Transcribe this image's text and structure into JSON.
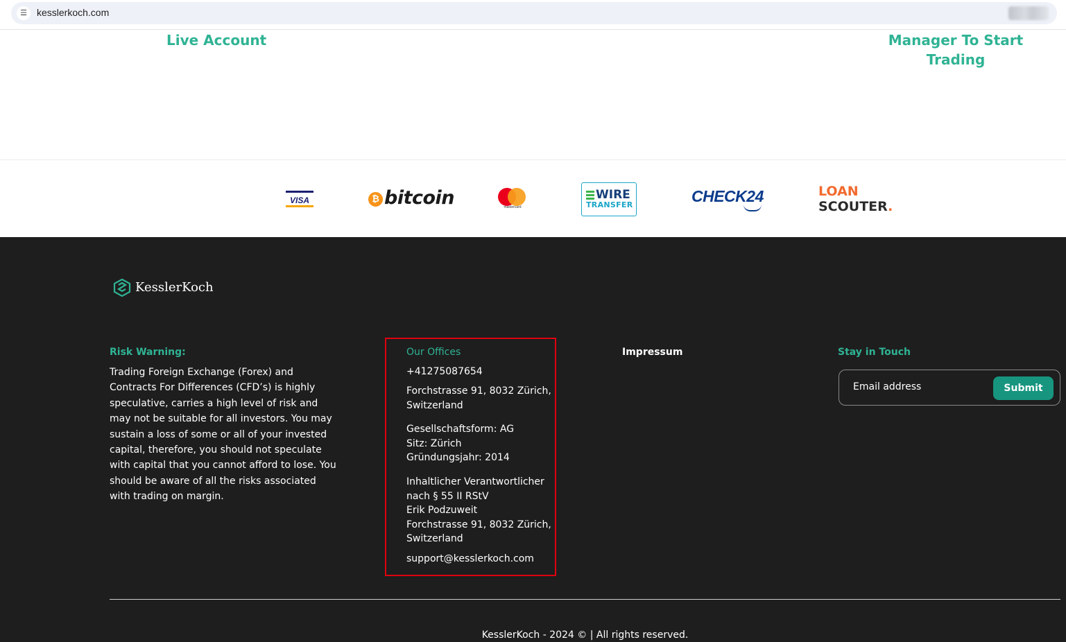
{
  "browser": {
    "url": "kesslerkoch.com",
    "site_info_icon": "tune-icon"
  },
  "hero": {
    "left_link": "Live Account",
    "right_link_line1": "Manager To Start",
    "right_link_line2": "Trading"
  },
  "partners": {
    "visa": "VISA",
    "bitcoin_symbol": "₿",
    "bitcoin": "bitcoin",
    "mastercard": "mastercard",
    "wire_line1": "WIRE",
    "wire_line2": "TRANSFER",
    "check24": "CHECK24",
    "loan_line1": "LOAN",
    "loan_line2": "SCOUTER",
    "loan_dot": "."
  },
  "footer": {
    "brand": "KesslerKoch",
    "risk": {
      "title": "Risk Warning:",
      "text": "Trading Foreign Exchange (Forex) and Contracts For Differences (CFD’s) is highly speculative, carries a high level of risk and may not be suitable for all investors. You may sustain a loss of some or all of your invested capital, therefore, you should not speculate with capital that you cannot afford to lose. You should be aware of all the risks associated with trading on margin."
    },
    "offices": {
      "title": "Our Offices",
      "phone": "+41275087654",
      "address_l1": "Forchstrasse 91, 8032 Zürich,",
      "address_l2": "Switzerland",
      "form": "Gesellschaftsform: AG",
      "seat": "Sitz: Zürich",
      "founded": "Gründungsjahr: 2014",
      "resp_l1": "Inhaltlicher Verantwortlicher",
      "resp_l2": "nach § 55 II RStV",
      "resp_l3": "Erik Podzuweit",
      "resp_l4": "Forchstrasse 91, 8032 Zürich,",
      "resp_l5": "Switzerland",
      "email": "support@kesslerkoch.com"
    },
    "impressum": "Impressum",
    "stay": {
      "title": "Stay in Touch",
      "email_placeholder": "Email address",
      "submit": "Submit"
    },
    "copyright": "KesslerKoch - 2024 © | All rights reserved."
  },
  "colors": {
    "accent": "#2fb394",
    "footer_bg": "#1e1e1e",
    "submit_bg": "#17957f",
    "highlight_box": "#e0000f"
  }
}
